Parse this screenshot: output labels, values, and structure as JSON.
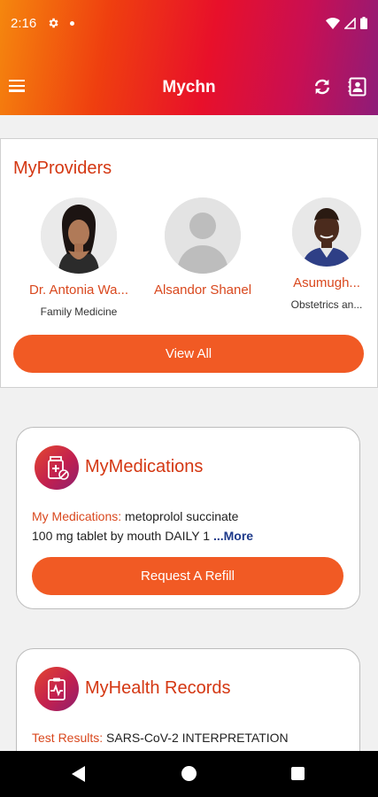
{
  "status_bar": {
    "time": "2:16"
  },
  "app_bar": {
    "title": "Mychn"
  },
  "providers": {
    "title": "MyProviders",
    "items": [
      {
        "name": "Dr. Antonia Wa...",
        "specialty": "Family Medicine"
      },
      {
        "name": "Alsandor Shanel",
        "specialty": ""
      },
      {
        "name": "Asumugh...",
        "specialty": "Obstetrics an..."
      }
    ],
    "view_all_label": "View All"
  },
  "medications": {
    "title": "MyMedications",
    "label": "My Medications:",
    "text_line1": " metoprolol succinate",
    "text_line2": "100 mg tablet by mouth DAILY  1 ",
    "more_label": "...More",
    "refill_label": "Request A Refill"
  },
  "health_records": {
    "title": "MyHealth Records",
    "label": "Test Results:",
    "text": " SARS-CoV-2 INTERPRETATION"
  },
  "colors": {
    "accent": "#f15a24",
    "title_red": "#d43712",
    "link_blue": "#1e3a8a"
  }
}
